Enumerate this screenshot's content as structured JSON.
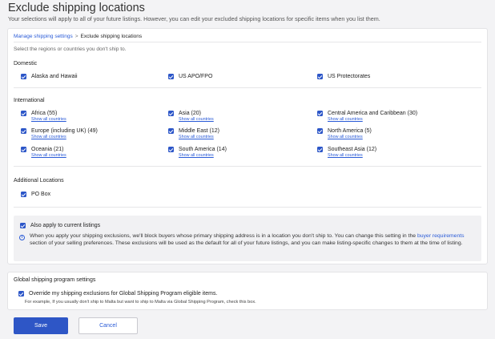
{
  "page": {
    "title": "Exclude shipping locations",
    "subtitle": "Your selections will apply to all of your future listings. However, you can edit your excluded shipping locations for specific items when you list them."
  },
  "breadcrumb": {
    "parent": "Manage shipping settings",
    "separator": ">",
    "current": "Exclude shipping locations"
  },
  "hint": "Select the regions or countries you don't ship to.",
  "domestic": {
    "label": "Domestic",
    "items": [
      {
        "label": "Alaska and Hawaii",
        "checked": true
      },
      {
        "label": "US APO/FPO",
        "checked": true
      },
      {
        "label": "US Protectorates",
        "checked": true
      }
    ]
  },
  "international": {
    "label": "International",
    "show_all": "Show all countries",
    "items": [
      {
        "label": "Africa (55)",
        "checked": true
      },
      {
        "label": "Asia (20)",
        "checked": true
      },
      {
        "label": "Central America and Caribbean (30)",
        "checked": true
      },
      {
        "label": "Europe (including UK) (49)",
        "checked": true
      },
      {
        "label": "Middle East (12)",
        "checked": true
      },
      {
        "label": "North America (5)",
        "checked": true
      },
      {
        "label": "Oceania (21)",
        "checked": true
      },
      {
        "label": "South America (14)",
        "checked": true
      },
      {
        "label": "Southeast Asia (12)",
        "checked": true
      }
    ]
  },
  "additional": {
    "label": "Additional Locations",
    "items": [
      {
        "label": "PO Box",
        "checked": true
      }
    ]
  },
  "apply_current": {
    "label": "Also apply to current listings",
    "checked": true,
    "info_before": "When you apply your shipping exclusions, we'll block buyers whose primary shipping address is in a location you don't ship to. You can change this setting in the ",
    "info_link": "buyer requirements",
    "info_after": " section of your selling preferences. These exclusions will be used as the default for all of your future listings, and you can make listing-specific changes to them at the time of listing."
  },
  "global_program": {
    "title": "Global shipping program settings",
    "override_label": "Override my shipping exclusions for Global Shipping Program eligible items.",
    "override_checked": true,
    "note": "For example, If you usually don't ship to Malta but want to ship to Malta via Global Shipping Program, check this box."
  },
  "buttons": {
    "save": "Save",
    "cancel": "Cancel"
  },
  "colors": {
    "accent": "#2e56c6",
    "link": "#2a5bd7"
  }
}
